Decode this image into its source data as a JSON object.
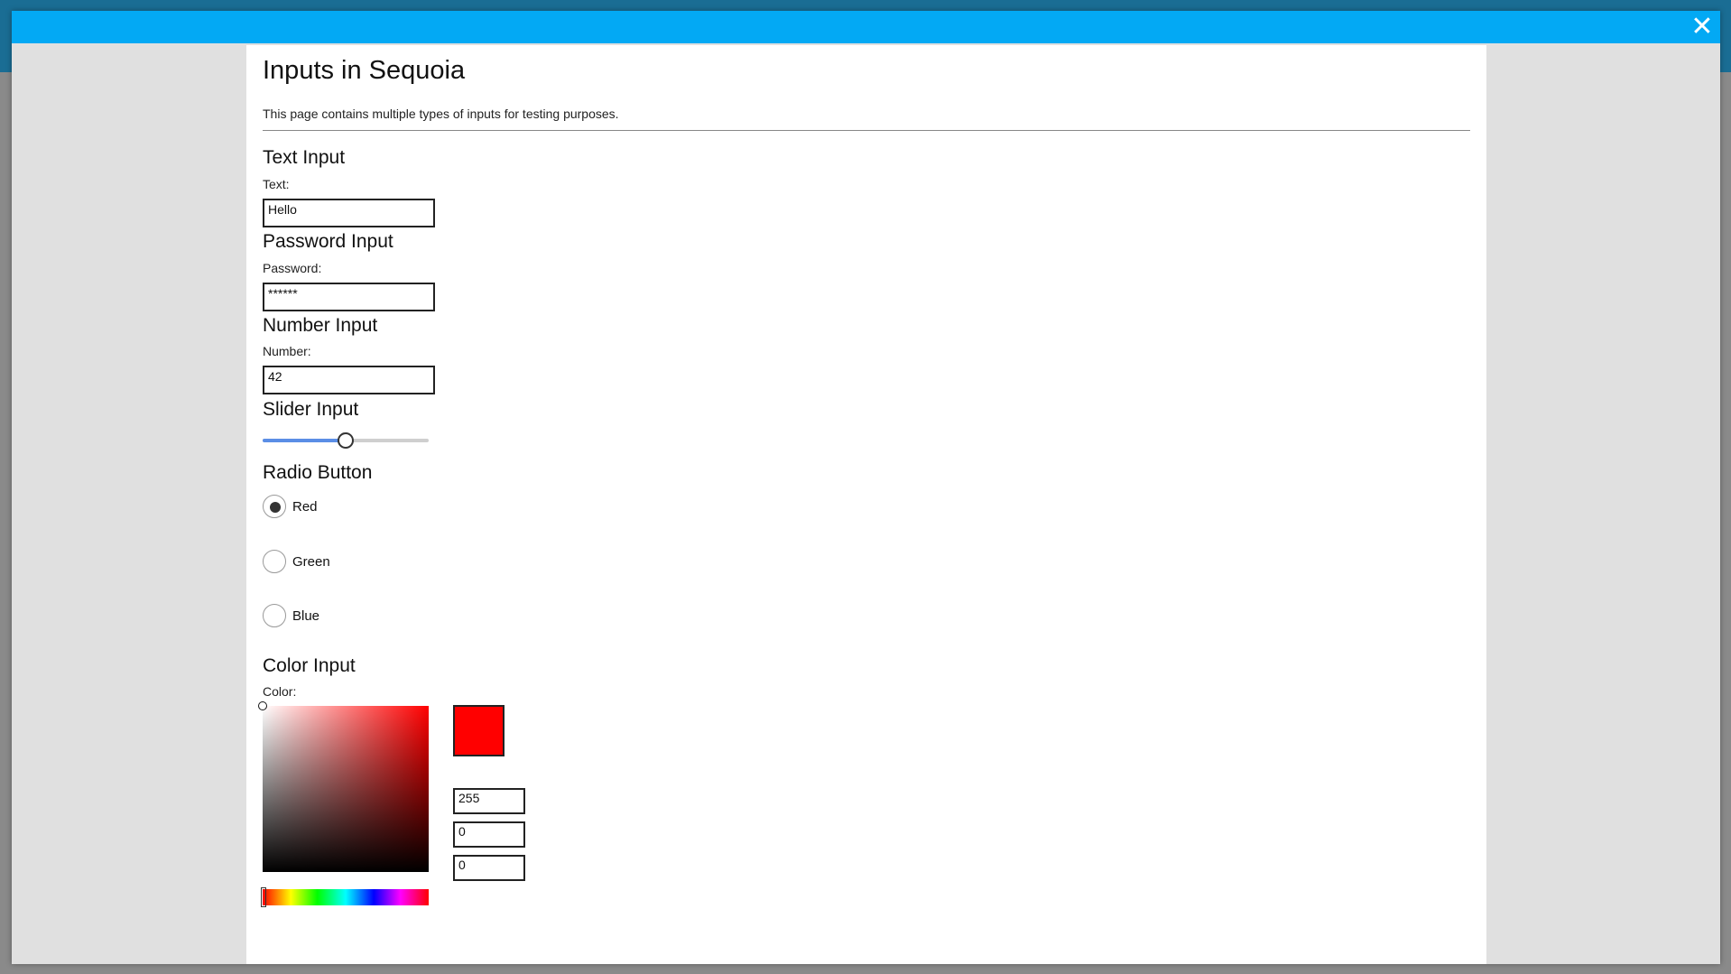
{
  "page": {
    "title": "Inputs in Sequoia",
    "description": "This page contains multiple types of inputs for testing purposes."
  },
  "modal": {
    "close_icon": "close-icon",
    "header_color": "#03a9f4"
  },
  "text_input": {
    "heading": "Text Input",
    "label": "Text:",
    "value": "Hello"
  },
  "password_input": {
    "heading": "Password Input",
    "label": "Password:",
    "value": "******"
  },
  "number_input": {
    "heading": "Number Input",
    "label": "Number:",
    "value": "42"
  },
  "slider_input": {
    "heading": "Slider Input",
    "value_fraction": 0.5,
    "fill_color": "#5b8ee6"
  },
  "radio_button": {
    "heading": "Radio Button",
    "options": [
      {
        "label": "Red",
        "checked": true
      },
      {
        "label": "Green",
        "checked": false
      },
      {
        "label": "Blue",
        "checked": false
      }
    ]
  },
  "color_input": {
    "heading": "Color Input",
    "label": "Color:",
    "selected_color": "#ff0000",
    "r": "255",
    "g": "0",
    "b": "0"
  }
}
